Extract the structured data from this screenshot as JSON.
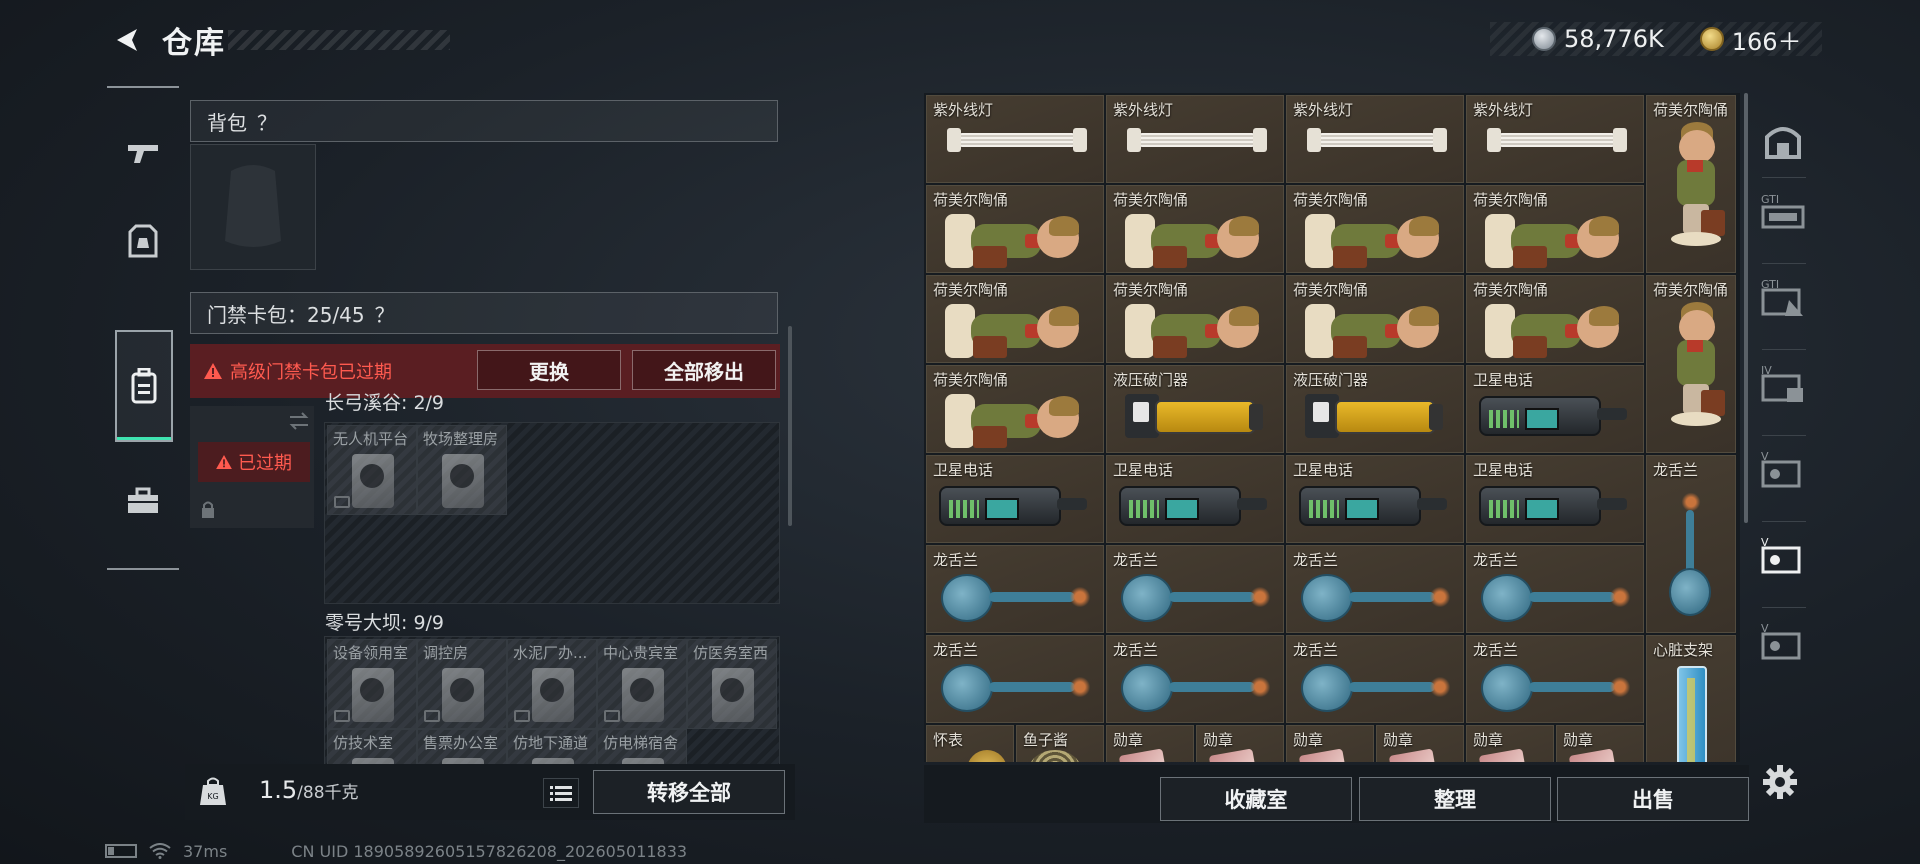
{
  "header": {
    "title": "仓库",
    "back_icon": "back-arrow-icon"
  },
  "currency": [
    {
      "icon": "silver-coin-icon",
      "value": "58,776K",
      "color": "#9aa4ad"
    },
    {
      "icon": "gold-coin-icon",
      "value": "166＋",
      "color": "#d4b24a"
    }
  ],
  "left_nav": [
    {
      "icon": "gun-icon"
    },
    {
      "icon": "armor-icon"
    },
    {
      "icon": "backpack-icon",
      "active": true
    },
    {
      "icon": "toolbox-icon"
    }
  ],
  "accent_color": "#3fe3b0",
  "backpack": {
    "label": "背包",
    "help": "？"
  },
  "keycard": {
    "label": "门禁卡包：25/45",
    "help": "？",
    "alert": "高级门禁卡包已过期",
    "replace_button": "更换",
    "remove_all_button": "全部移出",
    "expired_badge": "已过期",
    "sections": [
      {
        "label": "长弓溪谷: 2/9",
        "slots": [
          "无人机平台",
          "牧场整理房"
        ]
      },
      {
        "label": "零号大坝: 9/9",
        "slots": [
          "设备领用室",
          "调控房",
          "水泥厂办...",
          "中心贵宾室",
          "仿医务室西",
          "仿技术室",
          "售票办公室",
          "仿地下通道",
          "仿电梯宿舍"
        ]
      }
    ]
  },
  "footer_left": {
    "weight_value": "1.5",
    "weight_unit": "/88千克",
    "transfer_all": "转移全部"
  },
  "status": {
    "ping": "37ms",
    "uid": "CN UID 18905892605157826208_202605011833"
  },
  "items": [
    [
      "紫外线灯",
      "紫外线灯",
      "紫外线灯",
      "紫外线灯",
      "荷美尔陶俑"
    ],
    [
      "荷美尔陶俑",
      "荷美尔陶俑",
      "荷美尔陶俑",
      "荷美尔陶俑"
    ],
    [
      "荷美尔陶俑",
      "荷美尔陶俑",
      "荷美尔陶俑",
      "荷美尔陶俑",
      "荷美尔陶俑"
    ],
    [
      "荷美尔陶俑",
      "液压破门器",
      "液压破门器",
      "卫星电话"
    ],
    [
      "卫星电话",
      "卫星电话",
      "卫星电话",
      "卫星电话",
      "龙舌兰"
    ],
    [
      "龙舌兰",
      "龙舌兰",
      "龙舌兰",
      "龙舌兰"
    ],
    [
      "龙舌兰",
      "龙舌兰",
      "龙舌兰",
      "龙舌兰",
      "心脏支架"
    ],
    [
      "怀表",
      "鱼子酱",
      "勋章",
      "勋章",
      "勋章",
      "勋章",
      "勋章",
      "勋章"
    ]
  ],
  "right_nav": [
    {
      "icon": "storage-icon"
    },
    {
      "icon": "gti-case-icon",
      "label": "GTI"
    },
    {
      "icon": "gti-case-2-icon",
      "label": "GTI"
    },
    {
      "icon": "iv-case-icon",
      "label": "IV"
    },
    {
      "icon": "v-case-icon",
      "label": "V"
    },
    {
      "icon": "v-case-active-icon",
      "label": "V"
    },
    {
      "icon": "v-case-3-icon",
      "label": "V"
    }
  ],
  "actions": {
    "collection": "收藏室",
    "sort": "整理",
    "sell": "出售"
  }
}
